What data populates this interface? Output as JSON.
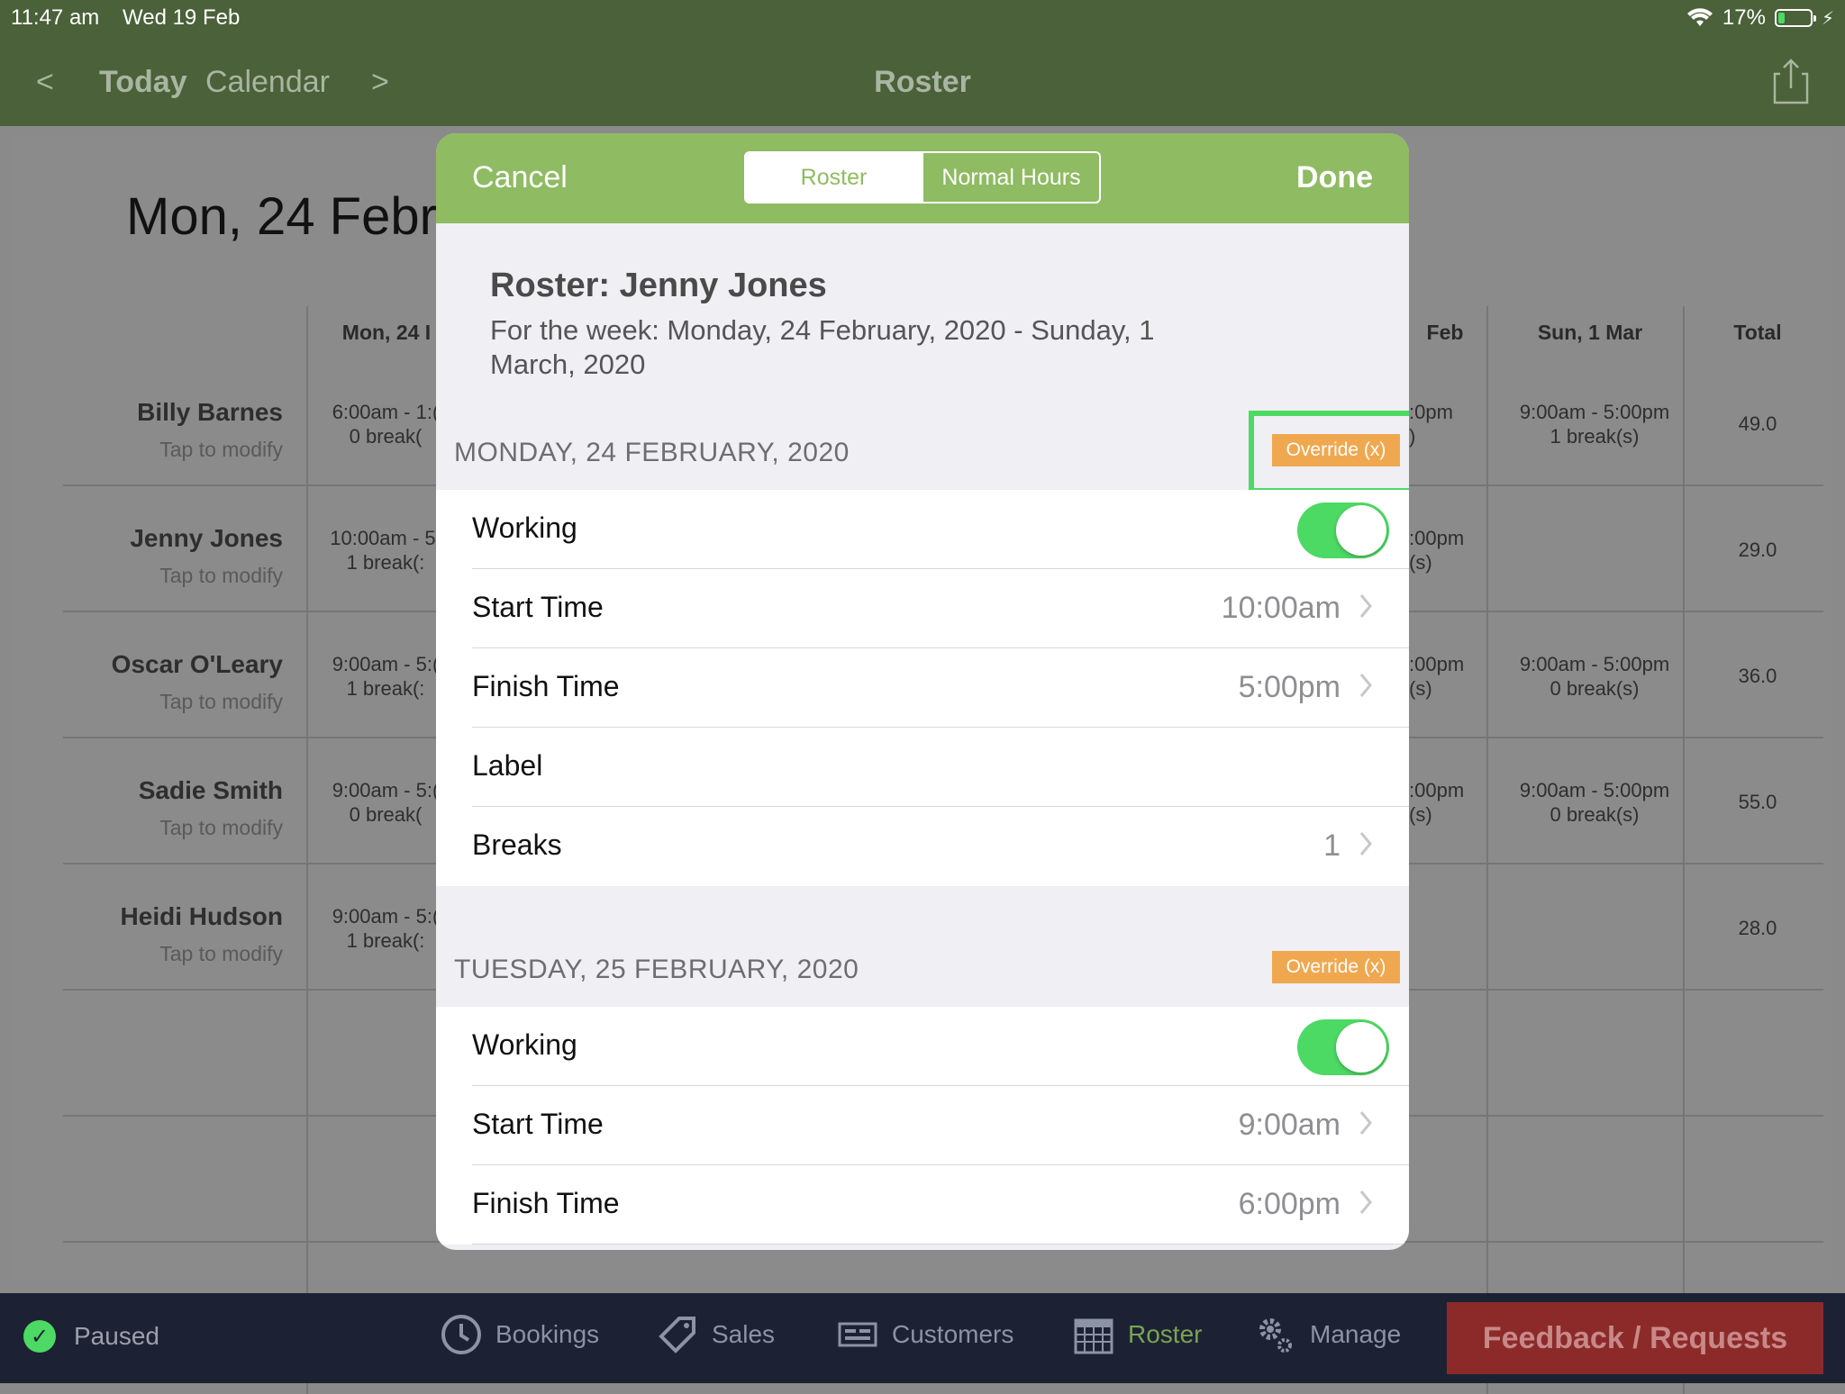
{
  "status": {
    "time": "11:47 am",
    "date": "Wed 19 Feb",
    "battery": "17%"
  },
  "nav": {
    "prev": "<",
    "today": "Today",
    "calendar": "Calendar",
    "next": ">",
    "title": "Roster"
  },
  "background": {
    "big_date": "Mon, 24 Febr",
    "columns": [
      "Mon, 24 I",
      "Feb",
      "Sun, 1 Mar",
      "Total"
    ],
    "tap_label": "Tap to modify",
    "employees": [
      {
        "name": "Billy Barnes",
        "mon1": "6:00am - 1:(",
        "mon2": "0 break(",
        "sat1": ":0pm",
        "sat2": ")",
        "sun1": "9:00am - 5:00pm",
        "sun2": "1 break(s)",
        "total": "49.0"
      },
      {
        "name": "Jenny Jones",
        "mon1": "10:00am - 5:",
        "mon2": "1 break(:",
        "sat1": ":00pm",
        "sat2": "(s)",
        "sun1": "",
        "sun2": "",
        "total": "29.0"
      },
      {
        "name": "Oscar O'Leary",
        "mon1": "9:00am - 5:(",
        "mon2": "1 break(:",
        "sat1": ":00pm",
        "sat2": "(s)",
        "sun1": "9:00am - 5:00pm",
        "sun2": "0 break(s)",
        "total": "36.0"
      },
      {
        "name": "Sadie Smith",
        "mon1": "9:00am - 5:(",
        "mon2": "0 break(",
        "sat1": ":00pm",
        "sat2": "(s)",
        "sun1": "9:00am - 5:00pm",
        "sun2": "0 break(s)",
        "total": "55.0"
      },
      {
        "name": "Heidi Hudson",
        "mon1": "9:00am - 5:(",
        "mon2": "1 break(:",
        "sat1": "",
        "sat2": "",
        "sun1": "",
        "sun2": "",
        "total": "28.0"
      }
    ]
  },
  "modal": {
    "cancel": "Cancel",
    "done": "Done",
    "segments": [
      "Roster",
      "Normal Hours"
    ],
    "title": "Roster: Jenny Jones",
    "subtitle": "For the week: Monday, 24 February, 2020 - Sunday, 1 March, 2020",
    "override_label": "Override (x)",
    "days": [
      {
        "heading": "MONDAY, 24 FEBRUARY, 2020",
        "working_label": "Working",
        "working": true,
        "start_label": "Start Time",
        "start": "10:00am",
        "finish_label": "Finish Time",
        "finish": "5:00pm",
        "label_label": "Label",
        "label": "",
        "breaks_label": "Breaks",
        "breaks": "1"
      },
      {
        "heading": "TUESDAY, 25 FEBRUARY, 2020",
        "working_label": "Working",
        "working": true,
        "start_label": "Start Time",
        "start": "9:00am",
        "finish_label": "Finish Time",
        "finish": "6:00pm"
      }
    ]
  },
  "tabbar": {
    "paused": "Paused",
    "tabs": [
      {
        "label": "Bookings",
        "icon": "clock-icon"
      },
      {
        "label": "Sales",
        "icon": "tag-icon"
      },
      {
        "label": "Customers",
        "icon": "register-icon"
      },
      {
        "label": "Roster",
        "icon": "calendar-icon",
        "active": true
      },
      {
        "label": "Manage",
        "icon": "gears-icon"
      }
    ],
    "feedback": "Feedback / Requests"
  },
  "colors": {
    "nav_green": "#4a6139",
    "modal_green": "#8fbb63",
    "override_orange": "#f0a850",
    "highlight_green": "#4ed964",
    "toggle_on": "#4cd964",
    "tabbar_bg": "#1c2233",
    "feedback_red": "#8c2a2a"
  }
}
